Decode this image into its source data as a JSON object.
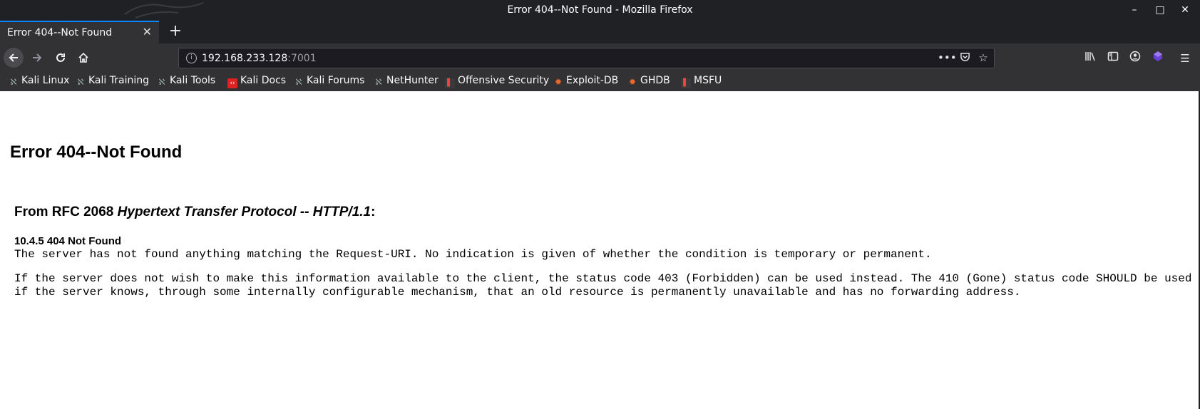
{
  "window": {
    "title": "Error 404--Not Found - Mozilla Firefox",
    "controls": {
      "minimize": "–",
      "maximize": "□",
      "close": "✕"
    }
  },
  "tabs": [
    {
      "label": "Error 404--Not Found",
      "active": true
    }
  ],
  "new_tab_label": "+",
  "navbar": {
    "url_host": "192.168.233.128",
    "url_port": ":7001",
    "icons": [
      "back-icon",
      "forward-icon",
      "reload-icon",
      "home-icon",
      "site-info-icon",
      "page-actions-icon",
      "pocket-icon",
      "bookmark-star-icon",
      "library-icon",
      "sidebar-icon",
      "account-icon",
      "extension-icon",
      "menu-icon"
    ]
  },
  "bookmarks": [
    {
      "label": "Kali Linux",
      "icon": "kali-dragon-icon"
    },
    {
      "label": "Kali Training",
      "icon": "kali-dragon-icon"
    },
    {
      "label": "Kali Tools",
      "icon": "kali-dragon-icon"
    },
    {
      "label": "Kali Docs",
      "icon": "kali-docs-icon"
    },
    {
      "label": "Kali Forums",
      "icon": "kali-dragon-icon"
    },
    {
      "label": "NetHunter",
      "icon": "kali-dragon-icon"
    },
    {
      "label": "Offensive Security",
      "icon": "offsec-icon"
    },
    {
      "label": "Exploit-DB",
      "icon": "exploitdb-icon"
    },
    {
      "label": "GHDB",
      "icon": "exploitdb-icon"
    },
    {
      "label": "MSFU",
      "icon": "offsec-icon"
    }
  ],
  "page": {
    "heading": "Error 404--Not Found",
    "rfc_prefix": "From RFC 2068 ",
    "rfc_title": "Hypertext Transfer Protocol -- HTTP/1.1",
    "rfc_suffix": ":",
    "section": "10.4.5 404 Not Found",
    "paragraph1": "The server has not found anything matching the Request-URI. No indication is given of whether the condition is temporary or permanent.",
    "paragraph2": "If the server does not wish to make this information available to the client, the status code 403 (Forbidden) can be used instead. The 410 (Gone) status code SHOULD be used if the server knows, through some internally configurable mechanism, that an old resource is permanently unavailable and has no forwarding address."
  },
  "colors": {
    "chrome_dark": "#202124",
    "toolbar": "#323234",
    "url_field": "#1c1b22",
    "tab_accent": "#0a84ff",
    "page_bg": "#ffffff"
  }
}
